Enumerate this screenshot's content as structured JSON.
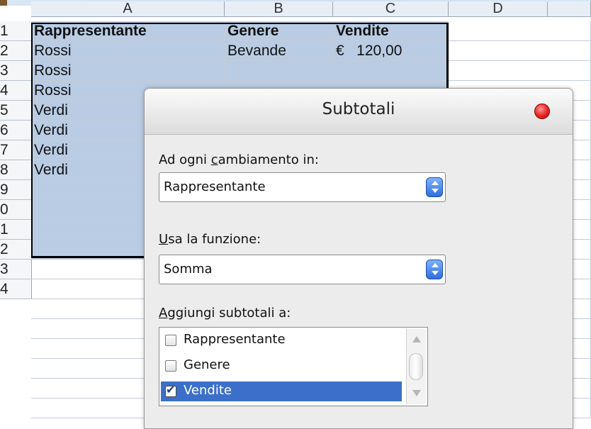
{
  "columns": [
    "A",
    "B",
    "C",
    "D"
  ],
  "rows": [
    "1",
    "2",
    "3",
    "4",
    "5",
    "6",
    "7",
    "8",
    "9",
    "0",
    "1",
    "2",
    "3",
    "4"
  ],
  "cells": {
    "r1": [
      "Rappresentante",
      "Genere",
      "Vendite"
    ],
    "r2": [
      "Rossi",
      "Bevande",
      "€   120,00"
    ],
    "r3": [
      "Rossi"
    ],
    "r4": [
      "Rossi"
    ],
    "r5": [
      "Verdi"
    ],
    "r6": [
      "Verdi"
    ],
    "r7": [
      "Verdi"
    ],
    "r8": [
      "Verdi"
    ]
  },
  "dialog": {
    "title": "Subtotali",
    "group_by": {
      "prefix": "Ad ogni ",
      "accel": "c",
      "suffix": "ambiamento in:",
      "value": "Rappresentante"
    },
    "function": {
      "accel": "U",
      "suffix": "sa la funzione:",
      "value": "Somma"
    },
    "add_to": {
      "accel": "A",
      "suffix": "ggiungi subtotali a:",
      "items": [
        {
          "label": "Rappresentante",
          "checked": false
        },
        {
          "label": "Genere",
          "checked": false
        },
        {
          "label": "Vendite",
          "checked": true
        }
      ]
    }
  },
  "colors": {
    "selection": "#b9cce4",
    "highlight": "#3b6fc9",
    "close": "#e33333"
  }
}
